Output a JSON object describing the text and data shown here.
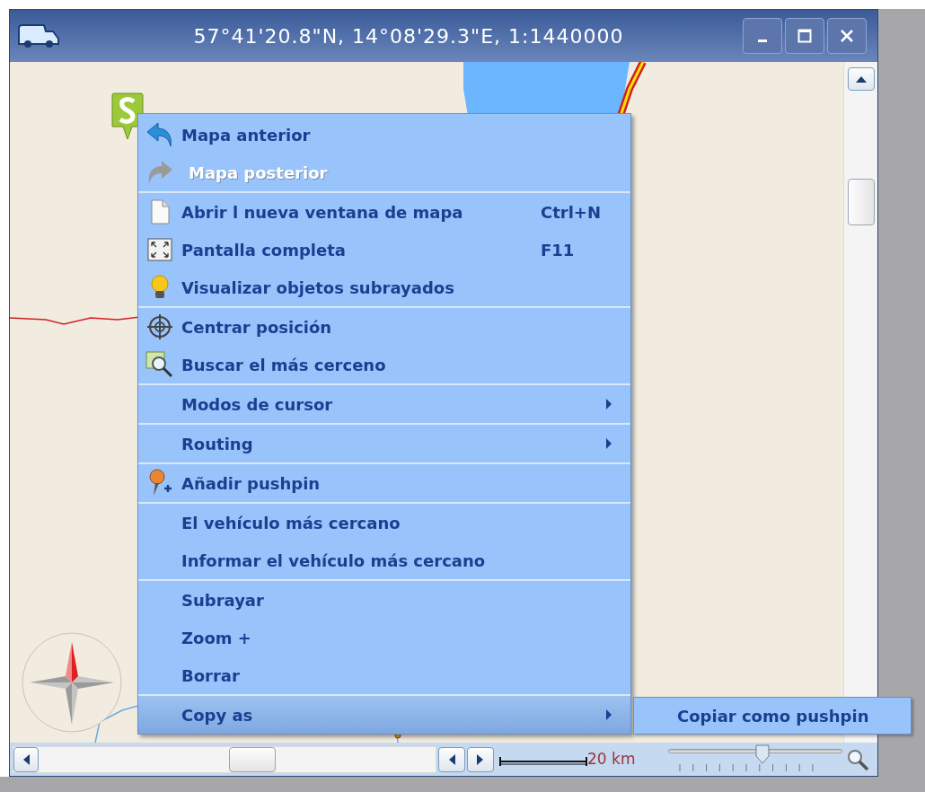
{
  "window": {
    "title": "57°41'20.8\"N, 14°08'29.3\"E, 1:1440000"
  },
  "context_menu": {
    "groups": [
      {
        "items": [
          {
            "label": "Mapa anterior",
            "disabled": false,
            "selected": false,
            "has_submenu": false
          },
          {
            "label": "Mapa posterior",
            "disabled": true,
            "selected": false,
            "has_submenu": false
          }
        ]
      },
      {
        "items": [
          {
            "label": "Abrir l nueva ventana de mapa",
            "shortcut": "Ctrl+N",
            "disabled": false,
            "selected": false,
            "has_submenu": false
          },
          {
            "label": "Pantalla completa",
            "shortcut": "F11",
            "disabled": false,
            "selected": false,
            "has_submenu": false
          },
          {
            "label": "Visualizar objetos subrayados",
            "disabled": false,
            "selected": false,
            "has_submenu": false
          }
        ]
      },
      {
        "items": [
          {
            "label": "Centrar  posición",
            "disabled": false,
            "selected": false,
            "has_submenu": false
          },
          {
            "label": "Buscar el más cerceno",
            "disabled": false,
            "selected": false,
            "has_submenu": false
          }
        ]
      },
      {
        "items": [
          {
            "label": "Modos de cursor",
            "disabled": false,
            "selected": false,
            "has_submenu": true
          }
        ]
      },
      {
        "items": [
          {
            "label": "Routing",
            "disabled": false,
            "selected": false,
            "has_submenu": true
          }
        ]
      },
      {
        "items": [
          {
            "label": "Añadir pushpin",
            "disabled": false,
            "selected": false,
            "has_submenu": false
          }
        ]
      },
      {
        "items": [
          {
            "label": "El vehículo más cercano",
            "disabled": false,
            "selected": false,
            "has_submenu": false
          },
          {
            "label": "Informar el vehículo más cercano",
            "disabled": false,
            "selected": false,
            "has_submenu": false
          }
        ]
      },
      {
        "items": [
          {
            "label": "Subrayar",
            "disabled": false,
            "selected": false,
            "has_submenu": false
          },
          {
            "label": "Zoom +",
            "disabled": false,
            "selected": false,
            "has_submenu": false
          },
          {
            "label": "Borrar",
            "disabled": false,
            "selected": false,
            "has_submenu": false
          }
        ]
      },
      {
        "items": [
          {
            "label": "Copy as",
            "disabled": false,
            "selected": true,
            "has_submenu": true
          }
        ]
      }
    ]
  },
  "submenu": {
    "items": [
      {
        "label": "Copiar como pushpin",
        "selected": false
      }
    ]
  },
  "scale": {
    "label": "20 km"
  },
  "zoom_slider": {
    "level": 0.54
  }
}
